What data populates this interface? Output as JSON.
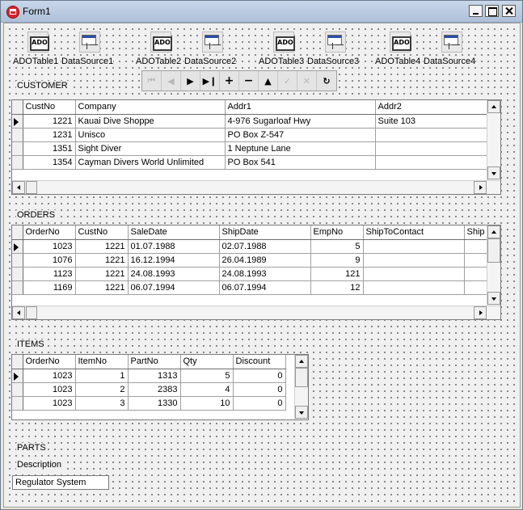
{
  "window": {
    "title": "Form1"
  },
  "components": [
    {
      "label": "ADOTable1",
      "icon": "ado-table-icon",
      "icon_text": "ADO"
    },
    {
      "label": "DataSource1",
      "icon": "datasource-icon"
    },
    {
      "label": "ADOTable2",
      "icon": "ado-table-icon",
      "icon_text": "ADO"
    },
    {
      "label": "DataSource2",
      "icon": "datasource-icon"
    },
    {
      "label": "ADOTable3",
      "icon": "ado-table-icon",
      "icon_text": "ADO"
    },
    {
      "label": "DataSource3",
      "icon": "datasource-icon"
    },
    {
      "label": "ADOTable4",
      "icon": "ado-table-icon",
      "icon_text": "ADO"
    },
    {
      "label": "DataSource4",
      "icon": "datasource-icon"
    }
  ],
  "navigator": {
    "buttons": [
      {
        "name": "first-record",
        "glyph": "⏮",
        "enabled": false
      },
      {
        "name": "prior-record",
        "glyph": "◀",
        "enabled": false
      },
      {
        "name": "next-record",
        "glyph": "▶",
        "enabled": true
      },
      {
        "name": "last-record",
        "glyph": "▶❙",
        "enabled": true
      },
      {
        "name": "insert-record",
        "glyph": "+",
        "enabled": true
      },
      {
        "name": "delete-record",
        "glyph": "−",
        "enabled": true
      },
      {
        "name": "edit-record",
        "glyph": "▲",
        "enabled": true
      },
      {
        "name": "post-record",
        "glyph": "✓",
        "enabled": false
      },
      {
        "name": "cancel-record",
        "glyph": "✕",
        "enabled": false
      },
      {
        "name": "refresh-record",
        "glyph": "↻",
        "enabled": true
      }
    ]
  },
  "customer": {
    "section_label": "CUSTOMER",
    "columns": [
      "CustNo",
      "Company",
      "Addr1",
      "Addr2"
    ],
    "rows": [
      [
        "1221",
        "Kauai Dive Shoppe",
        "4-976 Sugarloaf Hwy",
        "Suite 103"
      ],
      [
        "1231",
        "Unisco",
        "PO Box Z-547",
        ""
      ],
      [
        "1351",
        "Sight Diver",
        "1 Neptune Lane",
        ""
      ],
      [
        "1354",
        "Cayman Divers World Unlimited",
        "PO Box 541",
        ""
      ]
    ]
  },
  "orders": {
    "section_label": "ORDERS",
    "columns": [
      "OrderNo",
      "CustNo",
      "SaleDate",
      "ShipDate",
      "EmpNo",
      "ShipToContact",
      "Ship"
    ],
    "rows": [
      [
        "1023",
        "1221",
        "01.07.1988",
        "02.07.1988",
        "5",
        "",
        ""
      ],
      [
        "1076",
        "1221",
        "16.12.1994",
        "26.04.1989",
        "9",
        "",
        ""
      ],
      [
        "1123",
        "1221",
        "24.08.1993",
        "24.08.1993",
        "121",
        "",
        ""
      ],
      [
        "1169",
        "1221",
        "06.07.1994",
        "06.07.1994",
        "12",
        "",
        ""
      ]
    ]
  },
  "items": {
    "section_label": "ITEMS",
    "columns": [
      "OrderNo",
      "ItemNo",
      "PartNo",
      "Qty",
      "Discount"
    ],
    "rows": [
      [
        "1023",
        "1",
        "1313",
        "5",
        "0"
      ],
      [
        "1023",
        "2",
        "2383",
        "4",
        "0"
      ],
      [
        "1023",
        "3",
        "1330",
        "10",
        "0"
      ]
    ]
  },
  "parts": {
    "section_label": "PARTS",
    "description_label": "Description",
    "description_value": "Regulator System"
  }
}
